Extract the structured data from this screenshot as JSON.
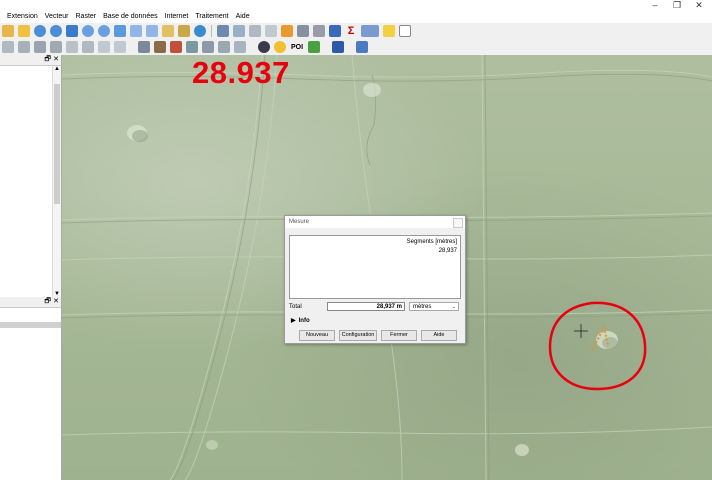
{
  "window": {
    "minimize": "–",
    "maximize": "❐",
    "close": "✕"
  },
  "menu": [
    "Extension",
    "Vecteur",
    "Raster",
    "Base de données",
    "Internet",
    "Traitement",
    "Aide"
  ],
  "toolbar": {
    "sigma": "Σ",
    "poi": "POI"
  },
  "panels": {
    "dock": "🗗",
    "close": "✕"
  },
  "overlay": {
    "measurement_label": "28.937"
  },
  "measure_dialog": {
    "title": "Mesure",
    "column_header": "Segments [mètres]",
    "segment_value": "28,937",
    "total_label": "Total",
    "total_value": "28,937 m",
    "unit": "mètres",
    "info_label": "Info",
    "buttons": {
      "new": "Nouveau",
      "config": "Configuration",
      "close": "Fermer",
      "help": "Aide"
    }
  },
  "colors": {
    "annotation_red": "#e8000e",
    "map_green": "#a6b896",
    "measure_orange": "#e8902a"
  }
}
